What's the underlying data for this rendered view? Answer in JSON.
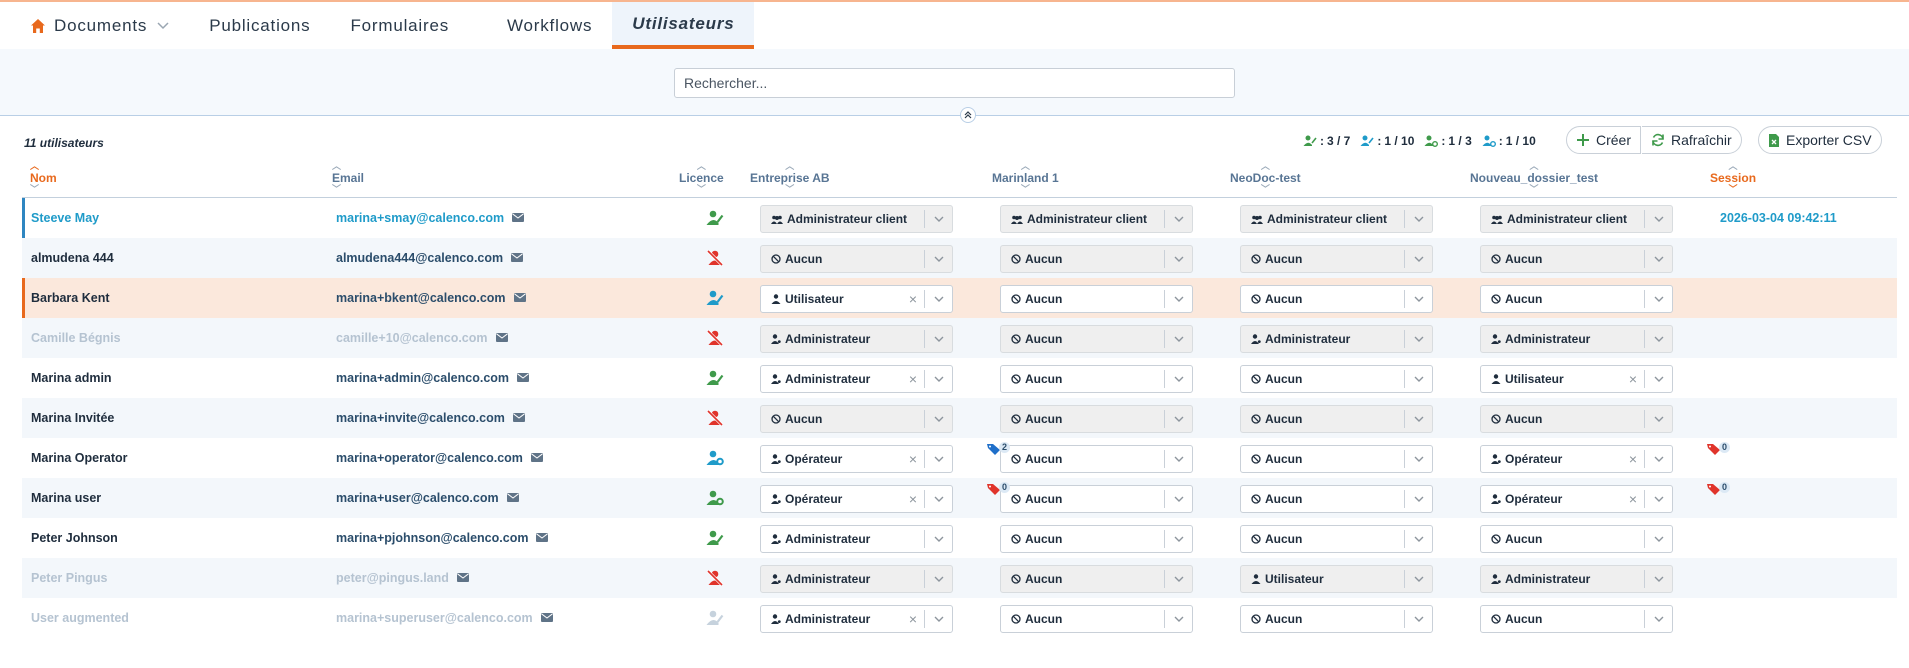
{
  "nav": {
    "items": [
      {
        "label": "Documents",
        "icon": "home-icon"
      },
      {
        "label": "Publications"
      },
      {
        "label": "Formulaires"
      },
      {
        "label": "Workflows"
      },
      {
        "label": "Utilisateurs",
        "active": true
      }
    ]
  },
  "search": {
    "placeholder": "Rechercher..."
  },
  "toolbar": {
    "count": "11 utilisateurs",
    "stats": [
      "3 / 7",
      "1 / 10",
      "1 / 3",
      "1 / 10"
    ],
    "create_label": "Créer",
    "refresh_label": "Rafraîchir",
    "export_label": "Exporter CSV"
  },
  "columns": {
    "nom": "Nom",
    "email": "Email",
    "licence": "Licence",
    "entreprise": "Entreprise AB",
    "marinland": "Marinland 1",
    "neodoc": "NeoDoc-test",
    "nouveau": "Nouveau_dossier_test",
    "session": "Session"
  },
  "rows": [
    {
      "name": "Steeve May",
      "email": "marina+smay@calenco.com",
      "lic": "green-user",
      "r": [
        "Administrateur client",
        "Administrateur client",
        "Administrateur client",
        "Administrateur client"
      ],
      "edit": [
        0,
        0,
        0,
        0
      ],
      "session": "2026-03-04 09:42:11",
      "state": "active"
    },
    {
      "name": "almudena 444",
      "email": "almudena444@calenco.com",
      "lic": "red-slash",
      "r": [
        "Aucun",
        "Aucun",
        "Aucun",
        "Aucun"
      ],
      "edit": [
        0,
        0,
        0,
        0
      ]
    },
    {
      "name": "Barbara Kent",
      "email": "marina+bkent@calenco.com",
      "lic": "blue-user",
      "r": [
        "Utilisateur",
        "Aucun",
        "Aucun",
        "Aucun"
      ],
      "edit": [
        2,
        1,
        1,
        1
      ],
      "state": "highlight"
    },
    {
      "name": "Camille Bégnis",
      "email": "camille+10@calenco.com",
      "lic": "red-slash",
      "r": [
        "Administrateur",
        "Aucun",
        "Administrateur",
        "Administrateur"
      ],
      "edit": [
        0,
        0,
        0,
        0
      ],
      "state": "disabled"
    },
    {
      "name": "Marina admin",
      "email": "marina+admin@calenco.com",
      "lic": "green-user",
      "r": [
        "Administrateur",
        "Aucun",
        "Aucun",
        "Utilisateur"
      ],
      "edit": [
        2,
        1,
        1,
        2
      ]
    },
    {
      "name": "Marina Invitée",
      "email": "marina+invite@calenco.com",
      "lic": "red-slash",
      "r": [
        "Aucun",
        "Aucun",
        "Aucun",
        "Aucun"
      ],
      "edit": [
        0,
        0,
        0,
        0
      ]
    },
    {
      "name": "Marina Operator",
      "email": "marina+operator@calenco.com",
      "lic": "blue-gear",
      "r": [
        "Opérateur",
        "Aucun",
        "Aucun",
        "Opérateur"
      ],
      "edit": [
        2,
        1,
        1,
        2
      ],
      "badges": [
        {
          "col": 1,
          "n": "2",
          "color": "blue"
        },
        {
          "col": 4,
          "n": "0",
          "color": "red"
        }
      ]
    },
    {
      "name": "Marina user",
      "email": "marina+user@calenco.com",
      "lic": "green-gear",
      "r": [
        "Opérateur",
        "Aucun",
        "Aucun",
        "Opérateur"
      ],
      "edit": [
        2,
        1,
        1,
        2
      ],
      "badges": [
        {
          "col": 1,
          "n": "0",
          "color": "red"
        },
        {
          "col": 4,
          "n": "0",
          "color": "red"
        }
      ]
    },
    {
      "name": "Peter Johnson",
      "email": "marina+pjohnson@calenco.com",
      "lic": "green-user",
      "r": [
        "Administrateur",
        "Aucun",
        "Aucun",
        "Aucun"
      ],
      "edit": [
        1,
        1,
        1,
        1
      ]
    },
    {
      "name": "Peter Pingus",
      "email": "peter@pingus.land",
      "lic": "red-slash",
      "r": [
        "Administrateur",
        "Aucun",
        "Utilisateur",
        "Administrateur"
      ],
      "edit": [
        0,
        0,
        0,
        0
      ],
      "state": "disabled"
    },
    {
      "name": "User augmented",
      "email": "marina+superuser@calenco.com",
      "lic": "grey-user",
      "r": [
        "Administrateur",
        "Aucun",
        "Aucun",
        "Aucun"
      ],
      "edit": [
        2,
        1,
        1,
        1
      ],
      "state": "disabled"
    }
  ],
  "colors": {
    "accent": "#e8691d",
    "blue": "#1f9bc9",
    "green": "#3f9a4b",
    "red": "#e0342b"
  }
}
